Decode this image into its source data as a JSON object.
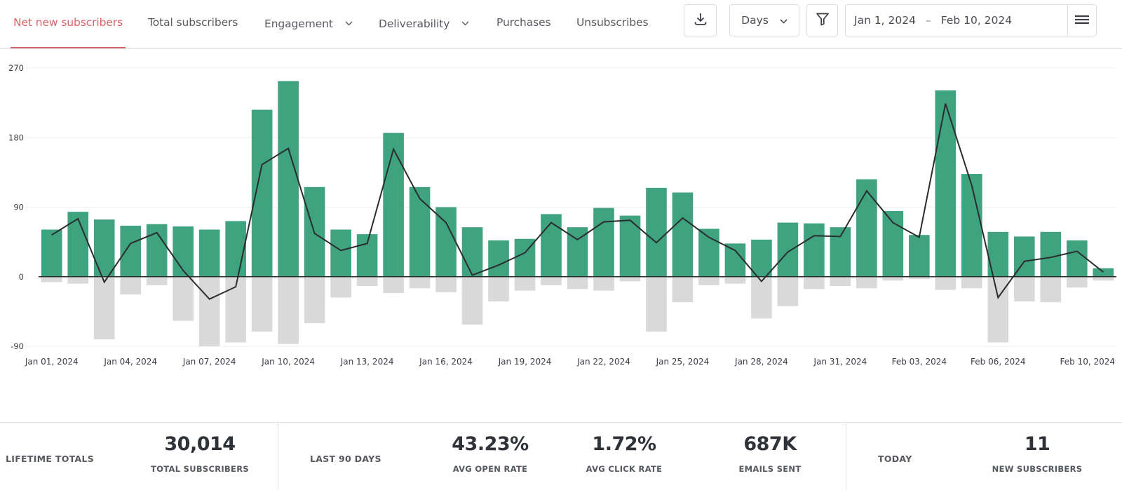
{
  "nav": {
    "tabs": [
      {
        "label": "Net new subscribers",
        "active": true,
        "dropdown": false
      },
      {
        "label": "Total subscribers",
        "active": false,
        "dropdown": false
      },
      {
        "label": "Engagement",
        "active": false,
        "dropdown": true
      },
      {
        "label": "Deliverability",
        "active": false,
        "dropdown": true
      },
      {
        "label": "Purchases",
        "active": false,
        "dropdown": false
      },
      {
        "label": "Unsubscribes",
        "active": false,
        "dropdown": false
      }
    ],
    "accent_color": "#d9646a"
  },
  "toolbar": {
    "download_icon": "download-icon",
    "granularity": "Days",
    "filter_icon": "filter-icon",
    "date_start": "Jan 1, 2024",
    "date_separator": "–",
    "date_end": "Feb 10, 2024",
    "menu_icon": "hamburger-menu-icon"
  },
  "chart_data": {
    "type": "bar",
    "title": "Net new subscribers",
    "xlabel": "",
    "ylabel": "",
    "ylim": [
      -90,
      270
    ],
    "yticks": [
      270,
      180,
      90,
      0,
      -90
    ],
    "grid": true,
    "x": [
      "Jan 01",
      "Jan 02",
      "Jan 03",
      "Jan 04",
      "Jan 05",
      "Jan 06",
      "Jan 07",
      "Jan 08",
      "Jan 09",
      "Jan 10",
      "Jan 11",
      "Jan 12",
      "Jan 13",
      "Jan 14",
      "Jan 15",
      "Jan 16",
      "Jan 17",
      "Jan 18",
      "Jan 19",
      "Jan 20",
      "Jan 21",
      "Jan 22",
      "Jan 23",
      "Jan 24",
      "Jan 25",
      "Jan 26",
      "Jan 27",
      "Jan 28",
      "Jan 29",
      "Jan 30",
      "Jan 31",
      "Feb 01",
      "Feb 02",
      "Feb 03",
      "Feb 04",
      "Feb 05",
      "Feb 06",
      "Feb 07",
      "Feb 08",
      "Feb 09",
      "Feb 10"
    ],
    "xtick_labels": [
      {
        "index": 0,
        "label": "Jan 01, 2024"
      },
      {
        "index": 3,
        "label": "Jan 04, 2024"
      },
      {
        "index": 6,
        "label": "Jan 07, 2024"
      },
      {
        "index": 9,
        "label": "Jan 10, 2024"
      },
      {
        "index": 12,
        "label": "Jan 13, 2024"
      },
      {
        "index": 15,
        "label": "Jan 16, 2024"
      },
      {
        "index": 18,
        "label": "Jan 19, 2024"
      },
      {
        "index": 21,
        "label": "Jan 22, 2024"
      },
      {
        "index": 24,
        "label": "Jan 25, 2024"
      },
      {
        "index": 27,
        "label": "Jan 28, 2024"
      },
      {
        "index": 30,
        "label": "Jan 31, 2024"
      },
      {
        "index": 33,
        "label": "Feb 03, 2024"
      },
      {
        "index": 36,
        "label": "Feb 06, 2024"
      },
      {
        "index": 40,
        "label": "Feb 10, 2024"
      }
    ],
    "series": [
      {
        "name": "New subscribers",
        "kind": "bar",
        "color": "#3fa37f",
        "values": [
          61,
          84,
          74,
          66,
          68,
          65,
          61,
          72,
          216,
          253,
          116,
          61,
          55,
          186,
          116,
          90,
          64,
          47,
          49,
          81,
          64,
          89,
          79,
          115,
          109,
          62,
          43,
          48,
          70,
          69,
          64,
          126,
          85,
          54,
          241,
          133,
          58,
          52,
          58,
          47,
          11
        ]
      },
      {
        "name": "Unsubscribes",
        "kind": "bar",
        "color": "#d9d9d9",
        "values": [
          -7,
          -9,
          -81,
          -23,
          -11,
          -57,
          -90,
          -85,
          -71,
          -87,
          -60,
          -27,
          -12,
          -21,
          -15,
          -20,
          -62,
          -32,
          -18,
          -11,
          -16,
          -18,
          -6,
          -71,
          -33,
          -11,
          -9,
          -54,
          -38,
          -16,
          -12,
          -15,
          -5,
          -3,
          -17,
          -15,
          -85,
          -32,
          -33,
          -14,
          -5
        ]
      },
      {
        "name": "Net new subscribers",
        "kind": "line",
        "color": "#2a2d2b",
        "values": [
          54,
          75,
          -7,
          43,
          57,
          8,
          -29,
          -13,
          145,
          166,
          56,
          34,
          43,
          165,
          101,
          70,
          2,
          15,
          31,
          70,
          48,
          71,
          73,
          44,
          76,
          51,
          34,
          -6,
          32,
          53,
          52,
          111,
          70,
          51,
          224,
          118,
          -27,
          20,
          25,
          33,
          6
        ]
      }
    ]
  },
  "stats": {
    "lifetime": {
      "label": "LIFETIME TOTALS",
      "items": [
        {
          "value": "30,014",
          "label": "TOTAL SUBSCRIBERS"
        }
      ]
    },
    "last90": {
      "label": "LAST 90 DAYS",
      "items": [
        {
          "value": "43.23%",
          "label": "AVG OPEN RATE"
        },
        {
          "value": "1.72%",
          "label": "AVG CLICK RATE"
        },
        {
          "value": "687K",
          "label": "EMAILS SENT"
        }
      ]
    },
    "today": {
      "label": "TODAY",
      "items": [
        {
          "value": "11",
          "label": "NEW SUBSCRIBERS"
        }
      ]
    }
  }
}
